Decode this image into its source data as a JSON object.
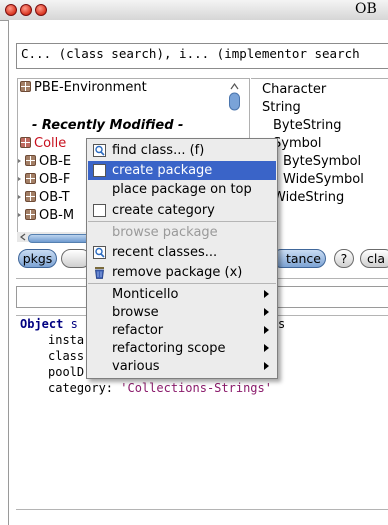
{
  "window": {
    "title": "OB"
  },
  "search": {
    "text": "C... (class search), i... (implementor search"
  },
  "packages": [
    {
      "label": "PBE-Environment",
      "kind": "package"
    },
    {
      "label": "- Recently Modified -",
      "kind": "heading"
    },
    {
      "label": "Colle",
      "kind": "package-selected"
    },
    {
      "label": "OB-E",
      "kind": "package-collapsed"
    },
    {
      "label": "OB-F",
      "kind": "package-collapsed"
    },
    {
      "label": "OB-T",
      "kind": "package-collapsed"
    },
    {
      "label": "OB-M",
      "kind": "package-collapsed"
    }
  ],
  "classes": [
    "Character",
    "String",
    "ByteString",
    "Symbol",
    "ByteSymbol",
    "WideSymbol",
    "WideString"
  ],
  "buttons": {
    "pkgs": "pkgs",
    "instance": "tance",
    "help": "?",
    "class": "cla"
  },
  "code": {
    "line1a": "Object",
    "line1b": "s",
    "line1c": "s",
    "line2": "insta",
    "line3": "class",
    "line4": "poolD",
    "line5a": "category: ",
    "line5b": "'Collections-Strings'"
  },
  "menu": {
    "items": [
      {
        "label": "find class... (f)",
        "icon": "magnifier-icon",
        "highlighted": false,
        "disabled": false,
        "submenu": false
      },
      {
        "label": "create package",
        "icon": "document-icon",
        "highlighted": true,
        "disabled": false,
        "submenu": false
      },
      {
        "label": "place package on top",
        "icon": "",
        "highlighted": false,
        "disabled": false,
        "submenu": false
      },
      {
        "label": "create category",
        "icon": "document-icon",
        "highlighted": false,
        "disabled": false,
        "submenu": false
      },
      {
        "label": "browse package",
        "icon": "",
        "highlighted": false,
        "disabled": true,
        "submenu": false
      },
      {
        "label": "recent classes...",
        "icon": "magnifier-icon",
        "highlighted": false,
        "disabled": false,
        "submenu": false
      },
      {
        "label": "remove package (x)",
        "icon": "trash-icon",
        "highlighted": false,
        "disabled": false,
        "submenu": false
      },
      {
        "label": "Monticello",
        "icon": "",
        "highlighted": false,
        "disabled": false,
        "submenu": true
      },
      {
        "label": "browse",
        "icon": "",
        "highlighted": false,
        "disabled": false,
        "submenu": true
      },
      {
        "label": "refactor",
        "icon": "",
        "highlighted": false,
        "disabled": false,
        "submenu": true
      },
      {
        "label": "refactoring scope",
        "icon": "",
        "highlighted": false,
        "disabled": false,
        "submenu": true
      },
      {
        "label": "various",
        "icon": "",
        "highlighted": false,
        "disabled": false,
        "submenu": true
      }
    ]
  },
  "colors": {
    "highlight": "#3a64c8",
    "selected_package": "#c8101e",
    "code_class": "#000080",
    "code_string": "#8a1a6b"
  }
}
